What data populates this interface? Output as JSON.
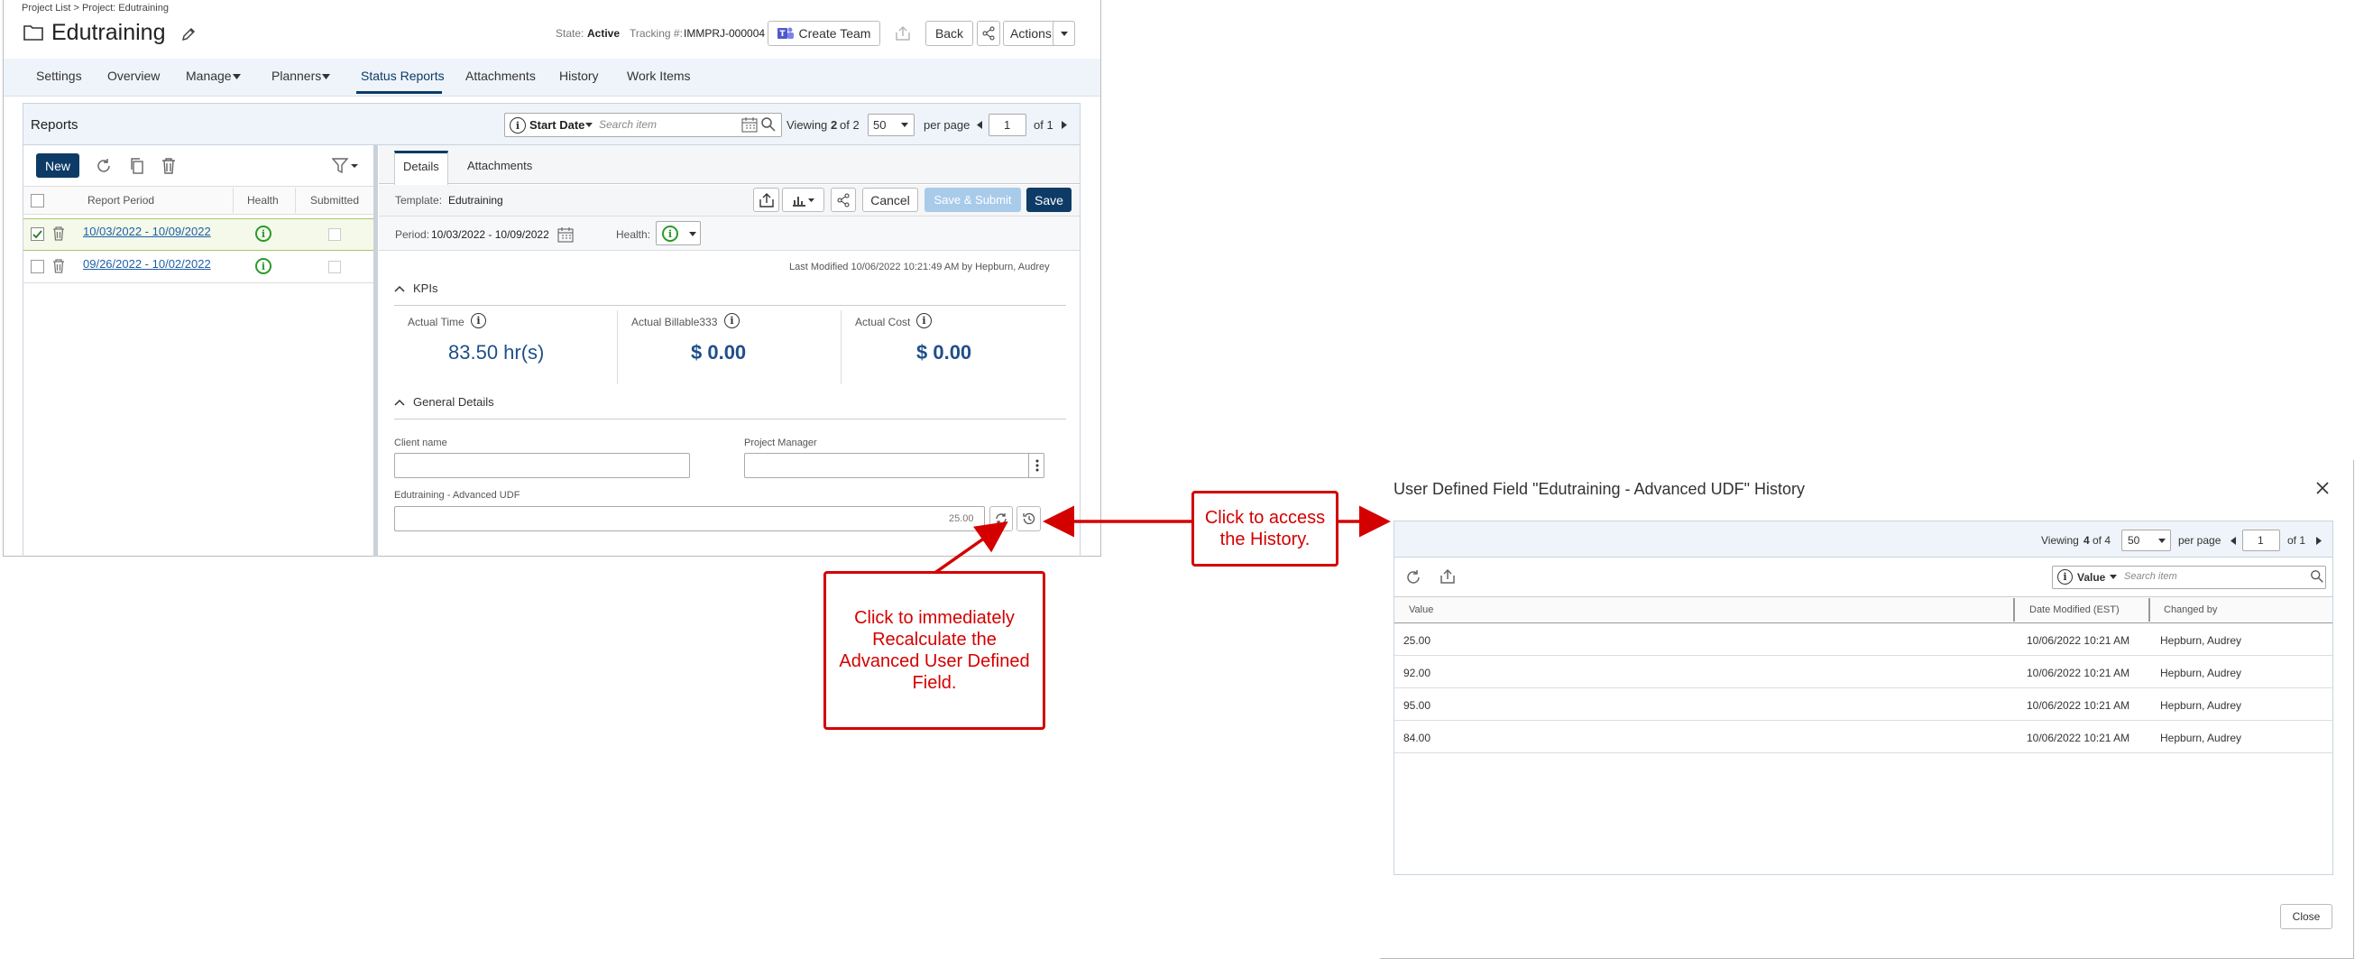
{
  "breadcrumb": "Project List > Project: Edutraining",
  "project": {
    "title": "Edutraining",
    "state_label": "State:",
    "state_value": "Active",
    "tracking_label": "Tracking #:",
    "tracking_value": "IMMPRJ-000004"
  },
  "header_buttons": {
    "create_team": "Create Team",
    "back": "Back",
    "actions": "Actions"
  },
  "nav_tabs": [
    "Settings",
    "Overview",
    "Manage",
    "Planners",
    "Status Reports",
    "Attachments",
    "History",
    "Work Items"
  ],
  "reports": {
    "title": "Reports",
    "filter_field": "Start Date",
    "search_placeholder": "Search item",
    "viewing": "Viewing",
    "viewing_bold": "2",
    "viewing_of": "of 2",
    "page_size": "50",
    "per_page": "per page",
    "page": "1",
    "of_pages": "of 1"
  },
  "list": {
    "new_label": "New",
    "columns": [
      "Report Period",
      "Health",
      "Submitted"
    ],
    "rows": [
      {
        "period": "10/03/2022 - 10/09/2022"
      },
      {
        "period": "09/26/2022 - 10/02/2022"
      }
    ]
  },
  "detail": {
    "tabs": [
      "Details",
      "Attachments"
    ],
    "template_label": "Template:",
    "template_value": "Edutraining",
    "cancel": "Cancel",
    "save_submit": "Save & Submit",
    "save": "Save",
    "period_label": "Period:",
    "period_value": "10/03/2022 - 10/09/2022",
    "health_label": "Health:",
    "last_modified": "Last Modified 10/06/2022 10:21:49 AM by Hepburn, Audrey",
    "kpis_title": "KPIs",
    "kpis": [
      {
        "label": "Actual Time",
        "value": "83.50 hr(s)"
      },
      {
        "label": "Actual Billable333",
        "value": "$ 0.00"
      },
      {
        "label": "Actual Cost",
        "value": "$ 0.00"
      }
    ],
    "general_title": "General Details",
    "client_label": "Client name",
    "pm_label": "Project Manager",
    "udf_label": "Edutraining - Advanced UDF",
    "udf_value": "25.00"
  },
  "dialog": {
    "title": "User Defined Field \"Edutraining - Advanced UDF\" History",
    "viewing": "Viewing",
    "viewing_bold": "4",
    "viewing_of": "of 4",
    "page_size": "50",
    "per_page": "per page",
    "page": "1",
    "of_pages": "of 1",
    "filter_field": "Value",
    "search_placeholder": "Search item",
    "columns": [
      "Value",
      "Date Modified (EST)",
      "Changed by"
    ],
    "rows": [
      {
        "value": "25.00",
        "date": "10/06/2022 10:21 AM",
        "by": "Hepburn, Audrey"
      },
      {
        "value": "92.00",
        "date": "10/06/2022 10:21 AM",
        "by": "Hepburn, Audrey"
      },
      {
        "value": "95.00",
        "date": "10/06/2022 10:21 AM",
        "by": "Hepburn, Audrey"
      },
      {
        "value": "84.00",
        "date": "10/06/2022 10:21 AM",
        "by": "Hepburn, Audrey"
      }
    ],
    "close": "Close"
  },
  "callouts": {
    "recalc": "Click to immediately Recalculate the Advanced User Defined Field.",
    "history": "Click to access the History."
  },
  "colors": {
    "accent": "#0d3b66",
    "link": "#1f5fa8",
    "health": "#2a9a2a",
    "callout": "#d40000"
  }
}
